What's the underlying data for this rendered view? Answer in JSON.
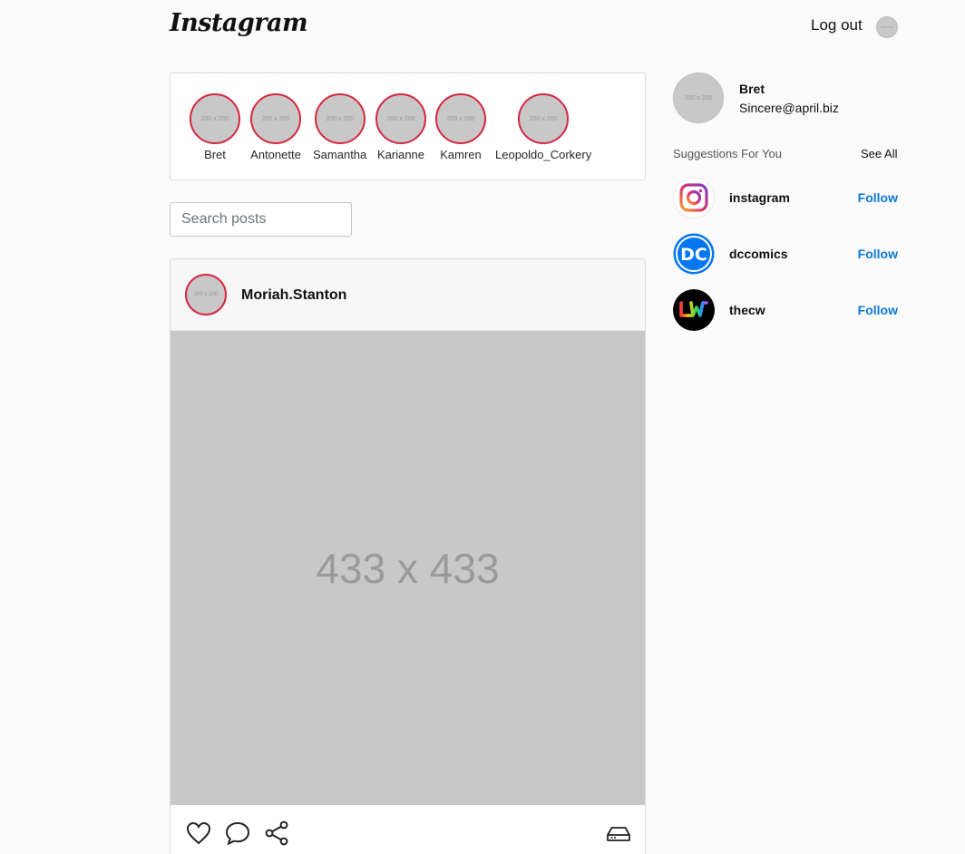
{
  "header": {
    "logo": "Instagram",
    "logout_label": "Log out",
    "avatar_text": "200 x 200"
  },
  "stories": [
    {
      "name": "Bret",
      "placeholder": "200 x 200"
    },
    {
      "name": "Antonette",
      "placeholder": "200 x 200"
    },
    {
      "name": "Samantha",
      "placeholder": "200 x 200"
    },
    {
      "name": "Karianne",
      "placeholder": "200 x 200"
    },
    {
      "name": "Kamren",
      "placeholder": "200 x 200"
    },
    {
      "name": "Leopoldo_Corkery",
      "placeholder": "200 x 200"
    }
  ],
  "search": {
    "placeholder": "Search posts",
    "value": ""
  },
  "post": {
    "username": "Moriah.Stanton",
    "avatar_text": "200 x 200",
    "image_text": "433 x 433",
    "actions": {
      "like_icon": "heart-icon",
      "comment_icon": "comment-icon",
      "share_icon": "share-icon",
      "save_icon": "save-icon"
    }
  },
  "profile": {
    "name": "Bret",
    "email": "Sincere@april.biz",
    "avatar_text": "200 x 200"
  },
  "suggestions": {
    "title": "Suggestions For You",
    "see_all": "See All",
    "items": [
      {
        "name": "instagram",
        "follow": "Follow",
        "icon": "instagram-logo-icon"
      },
      {
        "name": "dccomics",
        "follow": "Follow",
        "icon": "dc-logo-icon"
      },
      {
        "name": "thecw",
        "follow": "Follow",
        "icon": "cw-logo-icon"
      }
    ]
  },
  "colors": {
    "story_ring": "#d6273f",
    "follow_link": "#0f7ad8",
    "placeholder_gray": "#c8c8c8"
  }
}
